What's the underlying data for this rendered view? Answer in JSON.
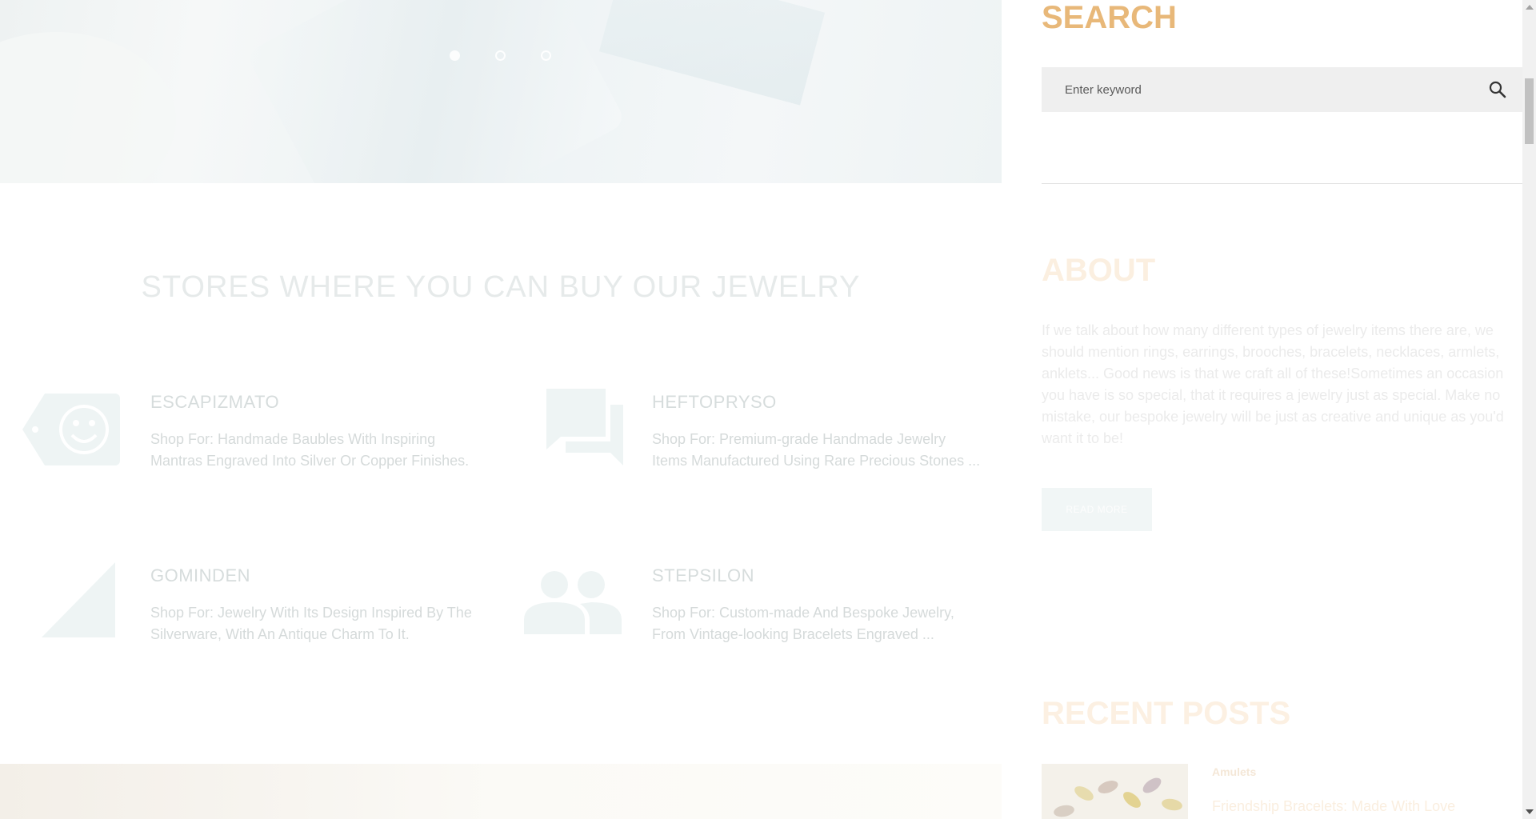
{
  "hero": {
    "slider_dots": [
      {
        "active": true
      },
      {
        "active": false
      },
      {
        "active": false
      }
    ]
  },
  "stores": {
    "title": "STORES WHERE YOU CAN BUY OUR JEWELRY",
    "items": [
      {
        "name": "ESCAPIZMATO",
        "icon": "smiley-tag-icon",
        "description_line1": "Shop For: Handmade Baubles With Inspiring",
        "description_line2": "Mantras Engraved Into Silver Or Copper Finishes."
      },
      {
        "name": "HEFTOPRYSO",
        "icon": "chat-bubbles-icon",
        "description_line1": "Shop For: Premium-grade Handmade Jewelry",
        "description_line2": "Items Manufactured Using Rare Precious Stones ..."
      },
      {
        "name": "GOMINDEN",
        "icon": "triangle-icon",
        "description_line1": "Shop For: Jewelry With Its Design Inspired By The",
        "description_line2": "Silverware, With An Antique Charm To It."
      },
      {
        "name": "STEPSILON",
        "icon": "people-icon",
        "description_line1": "Shop For: Custom-made And Bespoke Jewelry,",
        "description_line2": "From Vintage-looking Bracelets Engraved ..."
      }
    ]
  },
  "sidebar": {
    "search": {
      "title": "SEARCH",
      "placeholder": "Enter keyword"
    },
    "about": {
      "title": "ABOUT",
      "text": "If we talk about how many different types of jewelry items there are, we should mention rings, earrings, brooches, bracelets, necklaces, armlets, anklets... Good news is that we craft all of these!Sometimes an occasion you have is so special, that it requires a jewelry just as special. Make no mistake, our bespoke jewelry will be just as creative and unique as you'd want it to be!",
      "button_label": "READ MORE"
    },
    "recent_posts": {
      "title": "RECENT POSTS",
      "posts": [
        {
          "category": "Amulets",
          "title": "Friendship Bracelets: Made With Love"
        }
      ]
    }
  },
  "colors": {
    "accent": "#e8b879",
    "icon": "#eef4f4",
    "search_bg": "#efefef"
  }
}
